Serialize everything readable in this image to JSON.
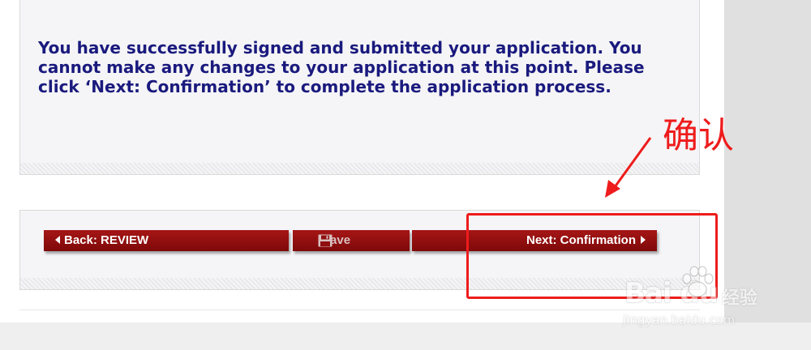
{
  "message": {
    "text": "You have successfully signed and submitted your application. You cannot make any changes to your application at this point. Please click ‘Next: Confirmation’ to complete the application process."
  },
  "nav": {
    "back_label": "Back: REVIEW",
    "save_label": "Save",
    "next_label": "Next: Confirmation"
  },
  "annotation": {
    "text": "确认",
    "color": "#ee1c1c"
  },
  "watermark": {
    "logo": "Bai du",
    "name": "经验",
    "url": "jingyan.baidu.com"
  },
  "colors": {
    "button_red": "#8f0f0f",
    "message_blue": "#1a1a7e",
    "panel_bg": "#f5f5f7"
  },
  "icons": {
    "back": "triangle-left-icon",
    "save": "floppy-disk-icon",
    "next": "triangle-right-icon"
  }
}
